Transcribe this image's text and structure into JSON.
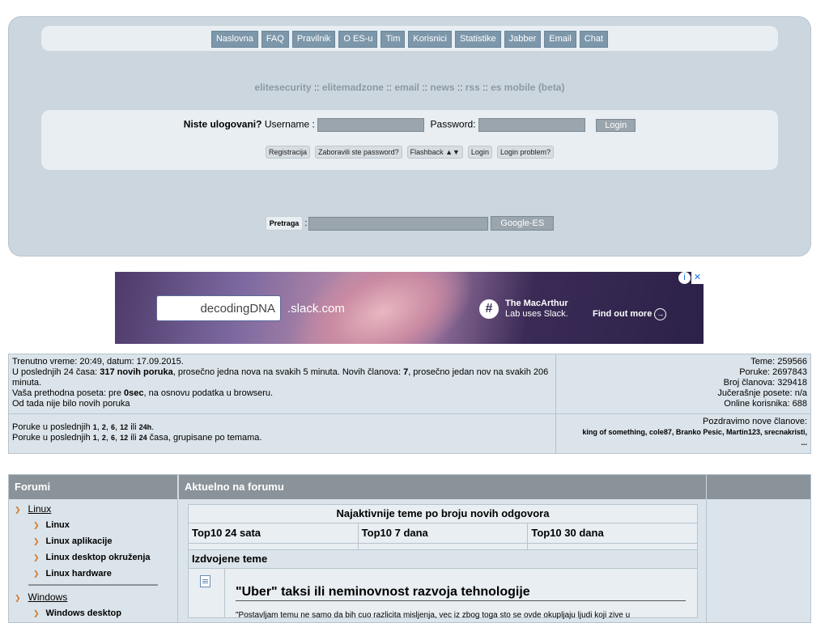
{
  "nav": {
    "items": [
      "Naslovna",
      "FAQ",
      "Pravilnik",
      "O ES-u",
      "Tim",
      "Korisnici",
      "Statistike",
      "Jabber",
      "Email",
      "Chat"
    ]
  },
  "links": {
    "items": [
      "elitesecurity",
      "elitemadzone",
      "email",
      "news",
      "rss",
      "es mobile (beta)"
    ],
    "separator": "::"
  },
  "login": {
    "status": "Niste ulogovani?",
    "username_label": "Username :",
    "password_label": "Password:",
    "login_button": "Login",
    "links": [
      "Registracija",
      "Zaboravili ste password?",
      "Flashback ▲▼",
      "Login",
      "Login problem?"
    ]
  },
  "search": {
    "label": "Pretraga",
    "colon": ":",
    "button": "Google-ES"
  },
  "ad": {
    "input_text": "decodingDNA",
    "domain": ".slack.com",
    "copy_line1": "The MacArthur",
    "copy_line2": "Lab uses Slack.",
    "cta": "Find out more",
    "info_icon": "info-icon",
    "close_icon": "close-icon"
  },
  "stats": {
    "time_line": "Trenutno vreme: 20:49, datum: 17.09.2015.",
    "posts24_prefix": "U poslednjih 24 časa: ",
    "posts24_count": "317 novih poruka",
    "posts24_mid": ", prosečno jedna nova na svakih 5 minuta. Novih članova: ",
    "new_members_count": "7",
    "posts24_suffix": ", prosečno jedan nov na svakih 206 minuta.",
    "last_visit_prefix": "Vaša prethodna poseta: pre ",
    "last_visit_value": "0sec",
    "last_visit_suffix": ", na osnovu podatka u browseru.",
    "no_new": "Od tada nije bilo novih poruka",
    "recent_prefix": "Poruke u poslednjih ",
    "recent_hours": [
      "1",
      "2",
      "6",
      "12",
      "24h"
    ],
    "recent_hours_grouped": [
      "1",
      "2",
      "6",
      "12",
      "24"
    ],
    "recent_grouped_suffix": " časa, grupisane po temama.",
    "ili": "ili",
    "right": {
      "teme": "Teme: 259566",
      "poruke": "Poruke: 2697843",
      "broj_clanova": "Broj članova: 329418",
      "jucerasnje": "Jučerašnje posete: n/a",
      "online": "Online korisnika: 688"
    },
    "greet": "Pozdravimo nove članove:",
    "new_members": "king of something, cole87, Branko Pesic, Martin123, srecnakristi,",
    "ellipsis": "..."
  },
  "forum": {
    "head_forums": "Forumi",
    "head_current": "Aktuelno na forumu",
    "categories": [
      {
        "label": "Linux",
        "subs": [
          "Linux",
          "Linux aplikacije",
          "Linux desktop okruženja",
          "Linux hardware"
        ]
      },
      {
        "label": "Windows",
        "subs": [
          "Windows desktop"
        ]
      }
    ],
    "most_active_title": "Najaktivnije teme po broju novih odgovora",
    "tops": [
      "Top10 24 sata",
      "Top10 7 dana",
      "Top10 30 dana"
    ],
    "featured_title": "Izdvojene teme",
    "featured_headline": "\"Uber\" taksi ili neminovnost razvoja tehnologije",
    "featured_excerpt": "\"Postavljam temu ne samo da bih cuo razlicita misljenja, vec iz zbog toga sto se ovde okupljaju ljudi koji zive u"
  },
  "colors": {
    "panel": "#cbd6df",
    "nav_button": "#7d97aa",
    "forum_header": "#8a9399",
    "bullet": "#d2762a"
  }
}
